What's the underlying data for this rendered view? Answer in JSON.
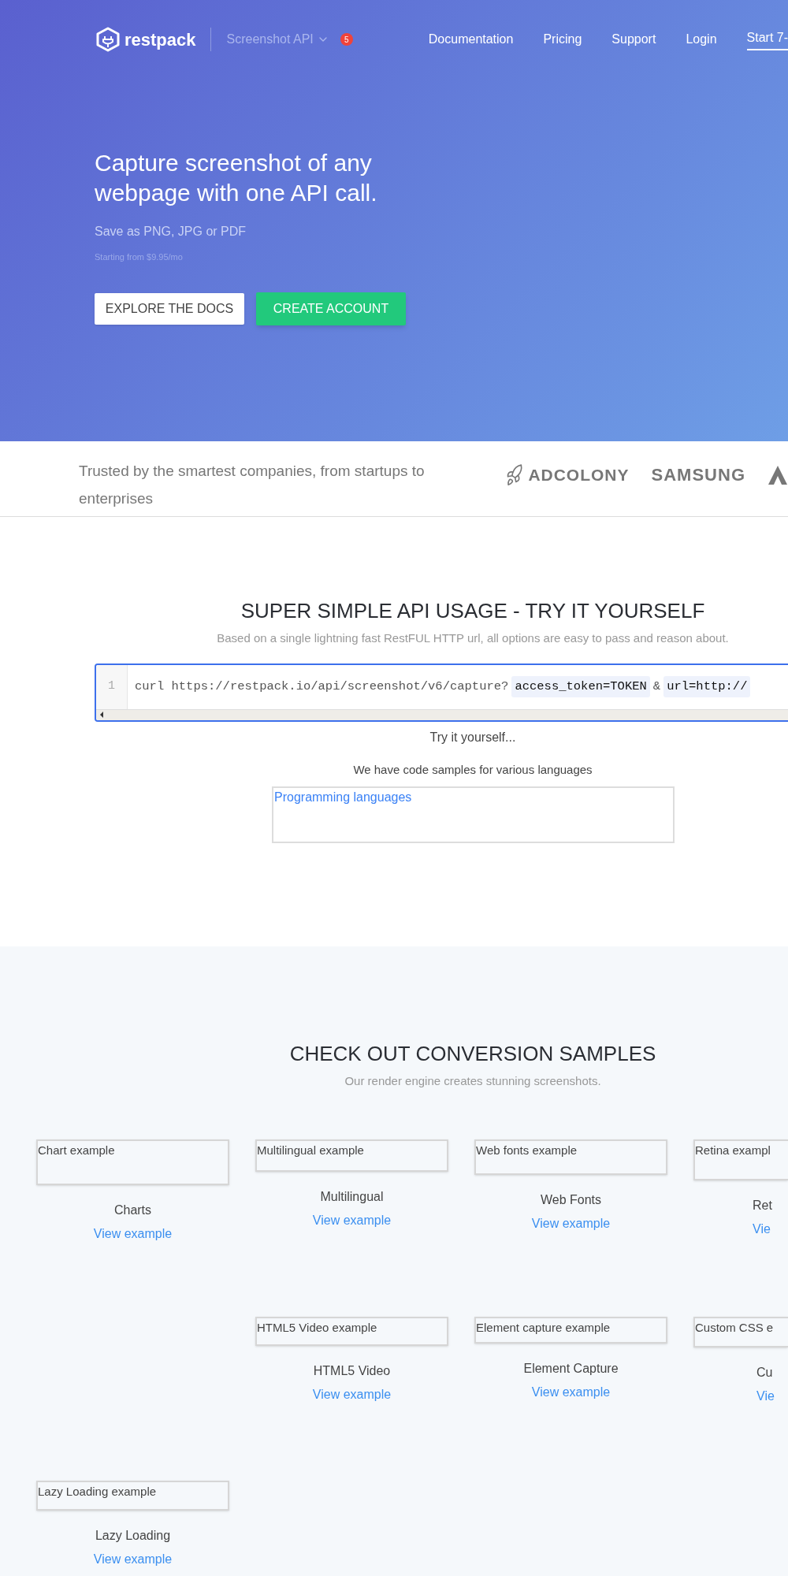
{
  "nav": {
    "logo": "restpack",
    "product": "Screenshot API",
    "badge": "5",
    "links": [
      {
        "label": "Documentation",
        "kind": "link"
      },
      {
        "label": "Pricing",
        "kind": "link"
      },
      {
        "label": "Support",
        "kind": "link"
      },
      {
        "label": "Login",
        "kind": "link"
      },
      {
        "label": "Start 7-",
        "kind": "cta"
      }
    ]
  },
  "hero": {
    "title_lines": [
      "Capture screenshot of any",
      "webpage with one API call."
    ],
    "subtitle": "Save as PNG, JPG or PDF",
    "price_note": "Starting from $9.95/mo",
    "buttons": [
      {
        "label": "EXPLORE THE DOCS",
        "kind": "secondary"
      },
      {
        "label": "CREATE ACCOUNT",
        "kind": "primary"
      }
    ]
  },
  "trusted": {
    "text": "Trusted by the smartest companies, from startups to enterprises",
    "logos": [
      {
        "kind": "rocket",
        "label": "ADCOLONY"
      },
      {
        "kind": "wordmark",
        "label": "SAMSUNG"
      },
      {
        "kind": "triangle"
      }
    ]
  },
  "api": {
    "title": "SUPER SIMPLE API USAGE - TRY IT YOURSELF",
    "subtitle": "Based on a single lightning fast RestFUL HTTP url, all options are easy to pass and reason about.",
    "code": {
      "line_number": "1",
      "parts": [
        {
          "kind": "text",
          "text": "curl https://restpack.io/api/screenshot/v6/capture?"
        },
        {
          "kind": "param",
          "text": "access_token=TOKEN"
        },
        {
          "kind": "text",
          "text": "&"
        },
        {
          "kind": "param",
          "text": "url=http://"
        }
      ]
    },
    "try_text": "Try it yourself...",
    "samples_text": "We have code samples for various languages",
    "languages_box": "Programming languages"
  },
  "samples": {
    "title": "CHECK OUT CONVERSION SAMPLES",
    "subtitle": "Our render engine creates stunning screenshots.",
    "items": [
      {
        "image_alt": "Chart example",
        "label": "Charts",
        "link": "View example"
      },
      {
        "image_alt": "Multilingual example",
        "label": "Multilingual",
        "link": "View example"
      },
      {
        "image_alt": "Web fonts example",
        "label": "Web Fonts",
        "link": "View example"
      },
      {
        "image_alt": "Retina exampl",
        "label": "Ret",
        "link": "Vie"
      },
      {
        "image_alt": "HTML5 Video example",
        "label": "HTML5 Video",
        "link": "View example"
      },
      {
        "image_alt": "Element capture example",
        "label": "Element Capture",
        "link": "View example"
      },
      {
        "image_alt": "Custom CSS e",
        "label": "Cu",
        "link": "Vie"
      },
      {
        "image_alt": "Lazy Loading example",
        "label": "Lazy Loading",
        "link": "View example"
      }
    ]
  }
}
